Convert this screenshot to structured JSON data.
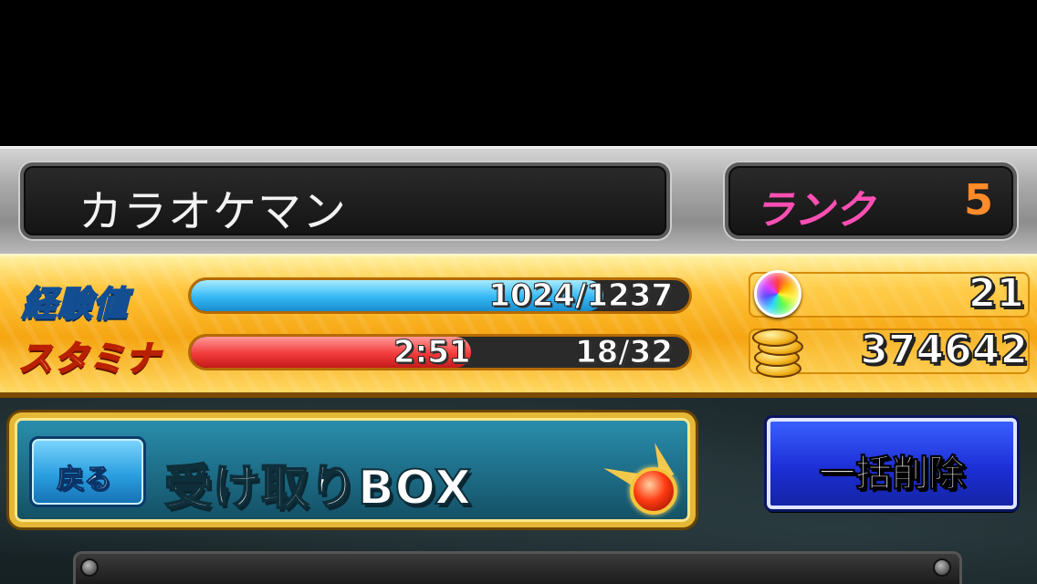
{
  "player": {
    "name": "カラオケマン",
    "rank_label": "ランク",
    "rank_value": "5"
  },
  "stats": {
    "exp_label": "経験値",
    "exp_text": "1024/1237",
    "exp_fill_fraction": 0.828,
    "stamina_label": "スタミナ",
    "stamina_timer": "2:51",
    "stamina_text": "18/32",
    "stamina_fill_fraction": 0.5625
  },
  "resources": {
    "orbs": "21",
    "gold": "374642"
  },
  "screen": {
    "back_label": "戻る",
    "title": "受け取りBOX",
    "bulk_delete_label": "一括削除"
  },
  "colors": {
    "rank_label": "#ff4fb4",
    "rank_value": "#ff8b2b",
    "exp_bar": "#34b8f4",
    "stamina_bar": "#f23b3b",
    "bulk_delete_button": "#1d2fd6"
  }
}
